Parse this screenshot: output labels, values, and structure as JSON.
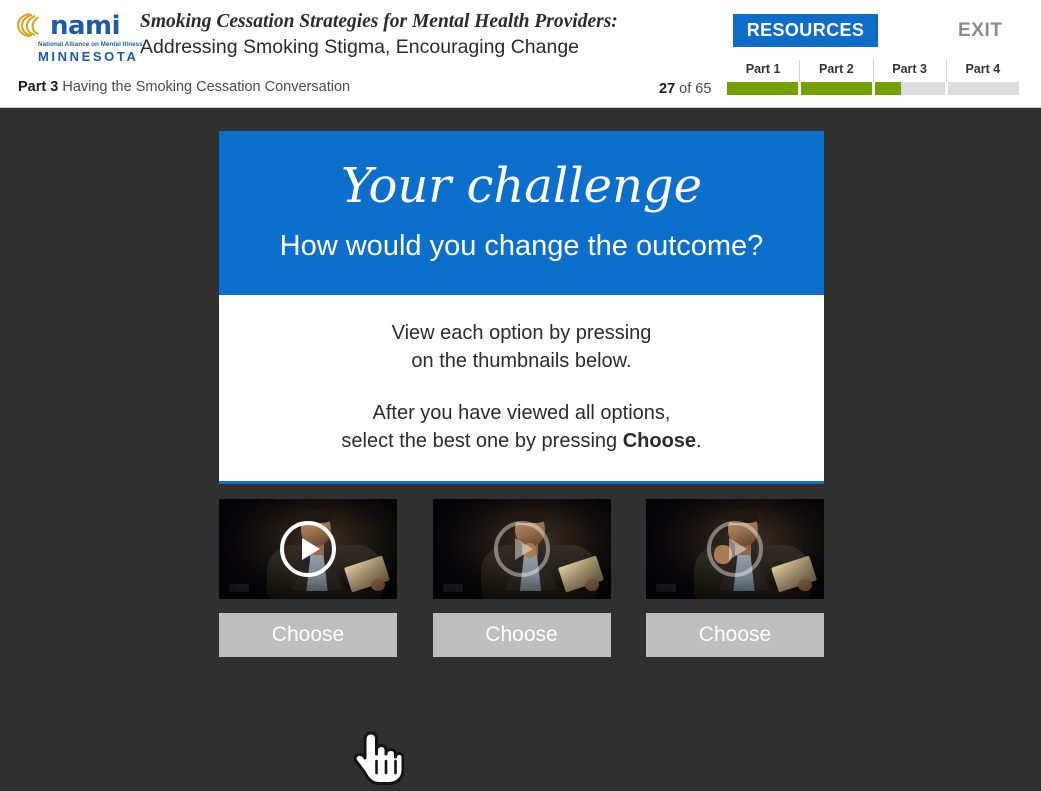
{
  "header": {
    "logo": {
      "name": "nami",
      "tagline": "National Alliance on Mental Illness",
      "state": "MINNESOTA"
    },
    "course_title_line1": "Smoking Cessation Strategies for Mental Health Providers:",
    "course_title_line2": "Addressing Smoking Stigma, Encouraging Change",
    "part_label": "Part 3",
    "part_name": "Having the Smoking Cessation Conversation",
    "resources_label": "RESOURCES",
    "exit_label": "EXIT",
    "counter_current": "27",
    "counter_rest": "of 65",
    "progress": {
      "parts": [
        {
          "label": "Part 1",
          "fill_percent": 100
        },
        {
          "label": "Part 2",
          "fill_percent": 100
        },
        {
          "label": "Part 3",
          "fill_percent": 37
        },
        {
          "label": "Part 4",
          "fill_percent": 0
        }
      ],
      "fill_color": "#74A001",
      "track_color": "#dcdcdc"
    }
  },
  "card": {
    "title": "Your challenge",
    "subtitle": "How would you change the outcome?",
    "paragraph1_line1": "View each option by pressing",
    "paragraph1_line2": "on the thumbnails below.",
    "paragraph2_line1": "After you have viewed all options,",
    "paragraph2_line2_pre": "select the best one by pressing ",
    "paragraph2_line2_bold": "Choose",
    "paragraph2_line2_post": ".",
    "header_color": "#0B6FCB",
    "body_color": "#FFFFFF"
  },
  "options": [
    {
      "play_icon": "play-icon",
      "choose_label": "Choose",
      "hovered": true
    },
    {
      "play_icon": "play-icon",
      "choose_label": "Choose",
      "hovered": false
    },
    {
      "play_icon": "play-icon",
      "choose_label": "Choose",
      "hovered": false
    }
  ],
  "cursor": {
    "icon": "pointing-hand-cursor"
  },
  "colors": {
    "accent_blue": "#0B6FCB",
    "resources_blue": "#0E6DC7",
    "stage_dark": "#303030",
    "choose_gray": "#BEBEBE",
    "progress_green": "#74A001",
    "nami_blue": "#1D5BA6",
    "nami_gold": "#D9A520"
  }
}
